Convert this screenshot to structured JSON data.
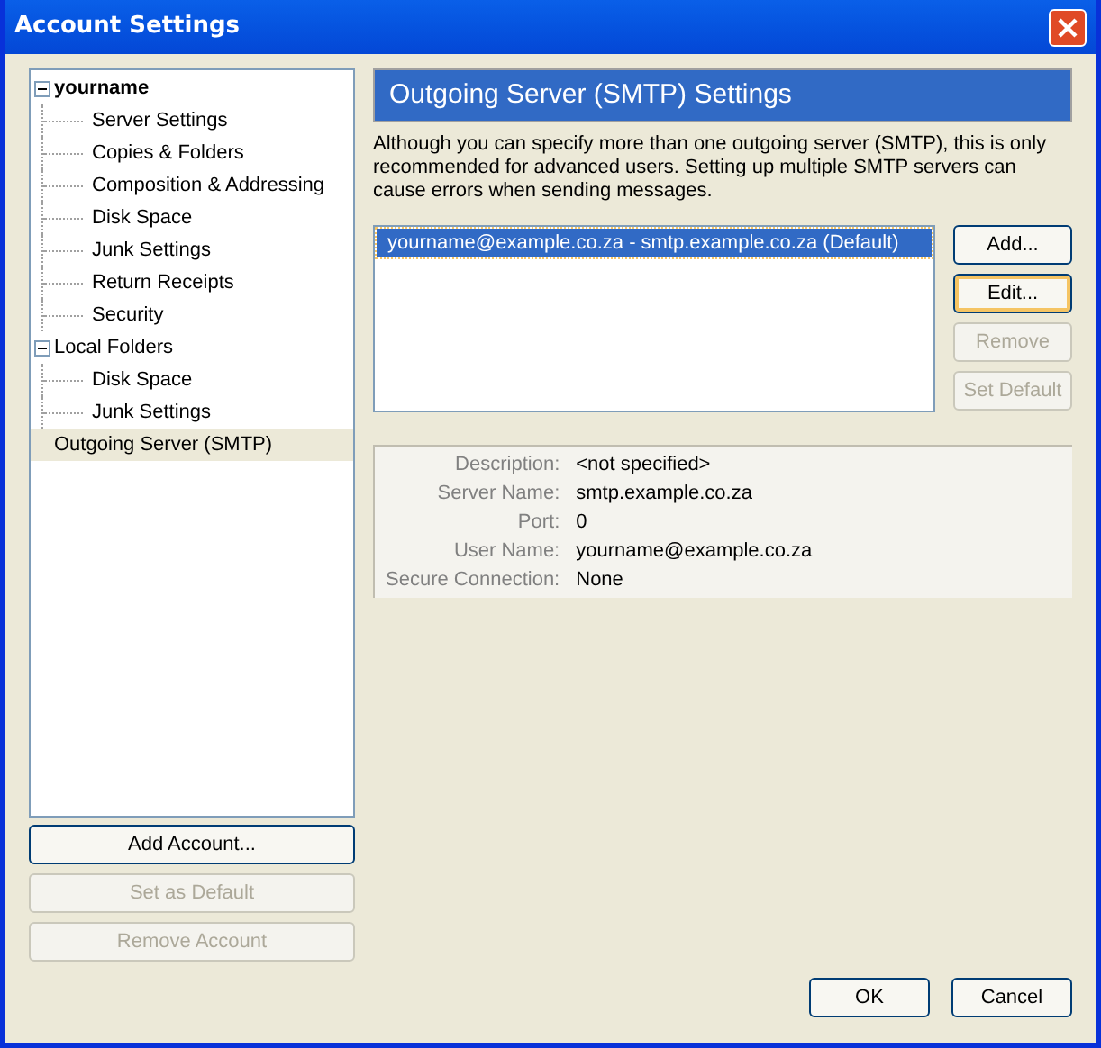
{
  "window": {
    "title": "Account Settings"
  },
  "tree": [
    {
      "label": "yourname",
      "bold": true,
      "expanded": true,
      "selected": false,
      "children": [
        {
          "label": "Server Settings",
          "selected": false
        },
        {
          "label": "Copies & Folders",
          "selected": false
        },
        {
          "label": "Composition & Addressing",
          "selected": false
        },
        {
          "label": "Disk Space",
          "selected": false
        },
        {
          "label": "Junk Settings",
          "selected": false
        },
        {
          "label": "Return Receipts",
          "selected": false
        },
        {
          "label": "Security",
          "selected": false
        }
      ]
    },
    {
      "label": "Local Folders",
      "bold": false,
      "expanded": true,
      "selected": false,
      "children": [
        {
          "label": "Disk Space",
          "selected": false
        },
        {
          "label": "Junk Settings",
          "selected": false
        }
      ]
    },
    {
      "label": "Outgoing Server (SMTP)",
      "bold": false,
      "selected": true
    }
  ],
  "account_buttons": [
    {
      "label": "Add Account...",
      "disabled": false
    },
    {
      "label": "Set as Default",
      "disabled": true
    },
    {
      "label": "Remove Account",
      "disabled": true
    }
  ],
  "panel": {
    "heading": "Outgoing Server (SMTP) Settings",
    "description": "Although you can specify more than one outgoing server (SMTP), this is only recommended for advanced users. Setting up multiple SMTP servers can cause errors when sending messages.",
    "servers": [
      {
        "label": "yourname@example.co.za - smtp.example.co.za (Default)",
        "selected": true
      }
    ],
    "server_buttons": [
      {
        "label": "Add...",
        "disabled": false,
        "focused": false
      },
      {
        "label": "Edit...",
        "disabled": false,
        "focused": true
      },
      {
        "label": "Remove",
        "disabled": true,
        "focused": false
      },
      {
        "label": "Set Default",
        "disabled": true,
        "focused": false
      }
    ],
    "details": [
      {
        "label": "Description:",
        "value": "<not specified>"
      },
      {
        "label": "Server Name:",
        "value": "smtp.example.co.za"
      },
      {
        "label": "Port:",
        "value": "0"
      },
      {
        "label": "User Name:",
        "value": "yourname@example.co.za"
      },
      {
        "label": "Secure Connection:",
        "value": "None"
      }
    ]
  },
  "dialog_buttons": [
    "OK",
    "Cancel"
  ]
}
